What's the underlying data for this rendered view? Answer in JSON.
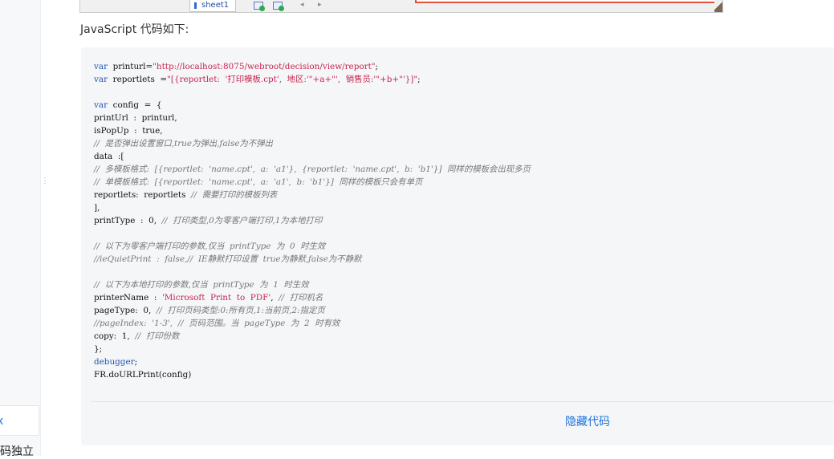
{
  "excel": {
    "sheet_tab": "sheet1",
    "arrow_left": "◂",
    "arrow_right": "▸"
  },
  "sidebar": {
    "card_label": "x",
    "partial_text": "码独立"
  },
  "article": {
    "intro": "JavaScript 代码如下:",
    "toggle_label": "隐藏代码"
  },
  "code": {
    "lines": [
      [
        [
          "kw",
          "var"
        ],
        [
          "",
          "  printurl="
        ],
        [
          "str",
          "\"http://localhost:8075/webroot/decision/view/report\""
        ],
        [
          "",
          ";"
        ]
      ],
      [
        [
          "kw",
          "var"
        ],
        [
          "",
          "  reportlets  ="
        ],
        [
          "str",
          "\"[{reportlet:  '打印模板.cpt',  地区:'\"+a+\"',  销售员:'\"+b+\"'}]\""
        ],
        [
          "",
          ";"
        ]
      ],
      [
        [
          "",
          ""
        ]
      ],
      [
        [
          "kw",
          "var"
        ],
        [
          "",
          "  config  =  {"
        ]
      ],
      [
        [
          "",
          "printUrl  :  printurl,"
        ]
      ],
      [
        [
          "",
          "isPopUp  :  true,"
        ]
      ],
      [
        [
          "cm",
          "//  是否弹出设置窗口,true为弹出,false为不弹出"
        ]
      ],
      [
        [
          "",
          "data  :["
        ]
      ],
      [
        [
          "cm",
          "//  多模板格式:  [{reportlet:  'name.cpt',  a:  'a1'},  {reportlet:  'name.cpt',  b:  'b1'}]  同样的模板会出现多页"
        ]
      ],
      [
        [
          "cm",
          "//  单模板格式:  [{reportlet:  'name.cpt',  a:  'a1',  b:  'b1'}]  同样的模板只会有单页"
        ]
      ],
      [
        [
          "",
          "reportlets:  reportlets  "
        ],
        [
          "cm",
          "//  需要打印的模板列表"
        ]
      ],
      [
        [
          "",
          "],"
        ]
      ],
      [
        [
          "",
          "printType  :  0,  "
        ],
        [
          "cm",
          "//  打印类型,0为零客户端打印,1为本地打印"
        ]
      ],
      [
        [
          "",
          ""
        ]
      ],
      [
        [
          "cm",
          "//  以下为零客户端打印的参数,仅当  printType  为  0  时生效"
        ]
      ],
      [
        [
          "cm",
          "//ieQuietPrint  :  false,//  IE静默打印设置  true为静默,false为不静默"
        ]
      ],
      [
        [
          "",
          ""
        ]
      ],
      [
        [
          "cm",
          "//  以下为本地打印的参数,仅当  printType  为  1  时生效"
        ]
      ],
      [
        [
          "",
          "printerName  :  "
        ],
        [
          "str",
          "'Microsoft  Print  to  PDF'"
        ],
        [
          "",
          ",  "
        ],
        [
          "cm",
          "//  打印机名"
        ]
      ],
      [
        [
          "",
          "pageType:  0,  "
        ],
        [
          "cm",
          "//  打印页码类型:0:所有页,1:当前页,2:指定页"
        ]
      ],
      [
        [
          "cm",
          "//pageIndex:  '1-3',  //  页码范围。当  pageType  为  2  时有效"
        ]
      ],
      [
        [
          "",
          "copy:  1,  "
        ],
        [
          "cm",
          "//  打印份数"
        ]
      ],
      [
        [
          "",
          "};"
        ]
      ],
      [
        [
          "kw",
          "debugger"
        ],
        [
          "",
          ";"
        ]
      ],
      [
        [
          "",
          "FR.doURLPrint(config)"
        ]
      ]
    ]
  }
}
